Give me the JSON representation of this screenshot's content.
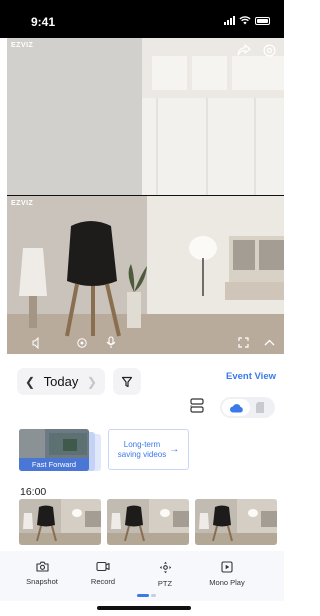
{
  "status_bar": {
    "time": "9:41"
  },
  "camera_feeds": [
    {
      "brand_logo": "EZVIZ",
      "view": "living-room-top"
    },
    {
      "brand_logo": "EZVIZ",
      "view": "living-room-bottom"
    }
  ],
  "date_bar": {
    "date_label": "Today",
    "event_view_label": "Event View"
  },
  "storage_toggle": {
    "active": "cloud",
    "options": [
      "cloud",
      "sd-card"
    ]
  },
  "cards": {
    "fast_forward_label": "Fast Forward",
    "long_term_line1": "Long-term",
    "long_term_line2": "saving videos",
    "long_term_arrow": "→"
  },
  "timeline": {
    "time_label": "16:00",
    "thumbnail_count": 3
  },
  "toolbar": {
    "items": [
      {
        "label": "Snapshot",
        "icon": "camera-icon"
      },
      {
        "label": "Record",
        "icon": "video-record-icon"
      },
      {
        "label": "PTZ",
        "icon": "ptz-icon"
      },
      {
        "label": "Mono Play",
        "icon": "mono-play-icon"
      }
    ]
  },
  "colors": {
    "accent": "#3b79e8",
    "toolbar_bg": "#f6f8fc",
    "fast_forward_bg": "#4a77d6"
  }
}
